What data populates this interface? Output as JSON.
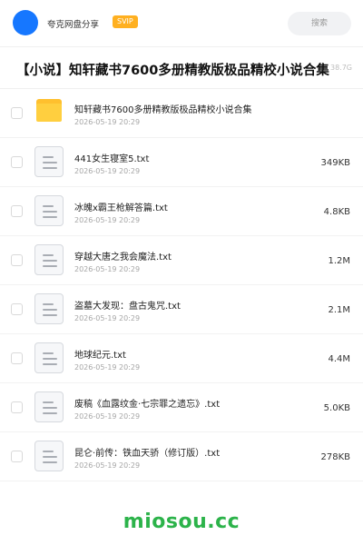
{
  "header": {
    "brand": "夸克网盘分享",
    "badge": "SVIP",
    "search_placeholder": "搜索"
  },
  "share": {
    "title": "【小说】知轩藏书7600多册精教版极品精校小说合集",
    "total_size": "38.7G"
  },
  "files": [
    {
      "name": "知轩藏书7600多册精教版极品精校小说合集",
      "date": "2026-05-19 20:29",
      "size": "",
      "type": "folder"
    },
    {
      "name": "441女生寝室5.txt",
      "date": "2026-05-19 20:29",
      "size": "349KB",
      "type": "txt"
    },
    {
      "name": "冰魄x霸王枪解答篇.txt",
      "date": "2026-05-19 20:29",
      "size": "4.8KB",
      "type": "txt"
    },
    {
      "name": "穿越大唐之我会魔法.txt",
      "date": "2026-05-19 20:29",
      "size": "1.2M",
      "type": "txt"
    },
    {
      "name": "盗墓大发现：盘古鬼咒.txt",
      "date": "2026-05-19 20:29",
      "size": "2.1M",
      "type": "txt"
    },
    {
      "name": "地球纪元.txt",
      "date": "2026-05-19 20:29",
      "size": "4.4M",
      "type": "txt"
    },
    {
      "name": "废稿《血露纹金·七宗罪之遗忘》.txt",
      "date": "2026-05-19 20:29",
      "size": "5.0KB",
      "type": "txt"
    },
    {
      "name": "昆仑·前传：铁血天骄（修订版）.txt",
      "date": "2026-05-19 20:29",
      "size": "278KB",
      "type": "txt"
    }
  ],
  "footer": {
    "watermark": "miosou.cc"
  },
  "colors": {
    "accent": "#1677ff",
    "badge": "#ffb020",
    "folder": "#ffcf3f",
    "watermark": "#2cb34a"
  },
  "icons": {
    "folder": "folder-icon",
    "txt": "text-file-icon",
    "avatar": "avatar"
  }
}
